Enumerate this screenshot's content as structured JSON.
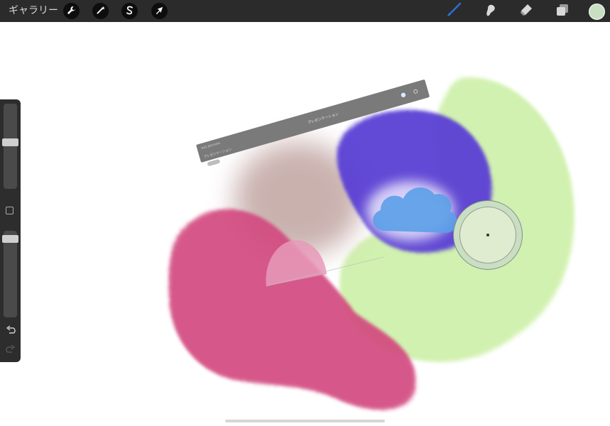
{
  "app": {
    "gallery_label": "ギャラリー"
  },
  "toolbar": {
    "left_tools": [
      {
        "name": "actions",
        "icon": "wrench-icon"
      },
      {
        "name": "adjustments",
        "icon": "magic-wand-icon"
      },
      {
        "name": "selection",
        "icon": "selection-s-icon"
      },
      {
        "name": "transform",
        "icon": "arrow-cursor-icon"
      }
    ],
    "right_tools": [
      {
        "name": "brush",
        "icon": "brush-icon",
        "active": true
      },
      {
        "name": "smudge",
        "icon": "smudge-icon",
        "active": false
      },
      {
        "name": "eraser",
        "icon": "eraser-icon",
        "active": false
      },
      {
        "name": "layers",
        "icon": "layers-icon",
        "active": false
      }
    ],
    "current_color": "#c8dfc2",
    "active_color": "#2d6fd6"
  },
  "sidebar": {
    "brush_size": 0.55,
    "brush_opacity": 0.95,
    "undo_icon": "undo-icon",
    "redo_icon": "redo-icon"
  },
  "colors": {
    "magenta": "#d2467e",
    "violet": "#5a3fd4",
    "light_green": "#cdf0a8",
    "mauve": "#b89894",
    "sky_blue": "#5b9fe8"
  },
  "screenshot": {
    "title": "プレゼンテーション",
    "left_label": "プレゼンテーション"
  }
}
